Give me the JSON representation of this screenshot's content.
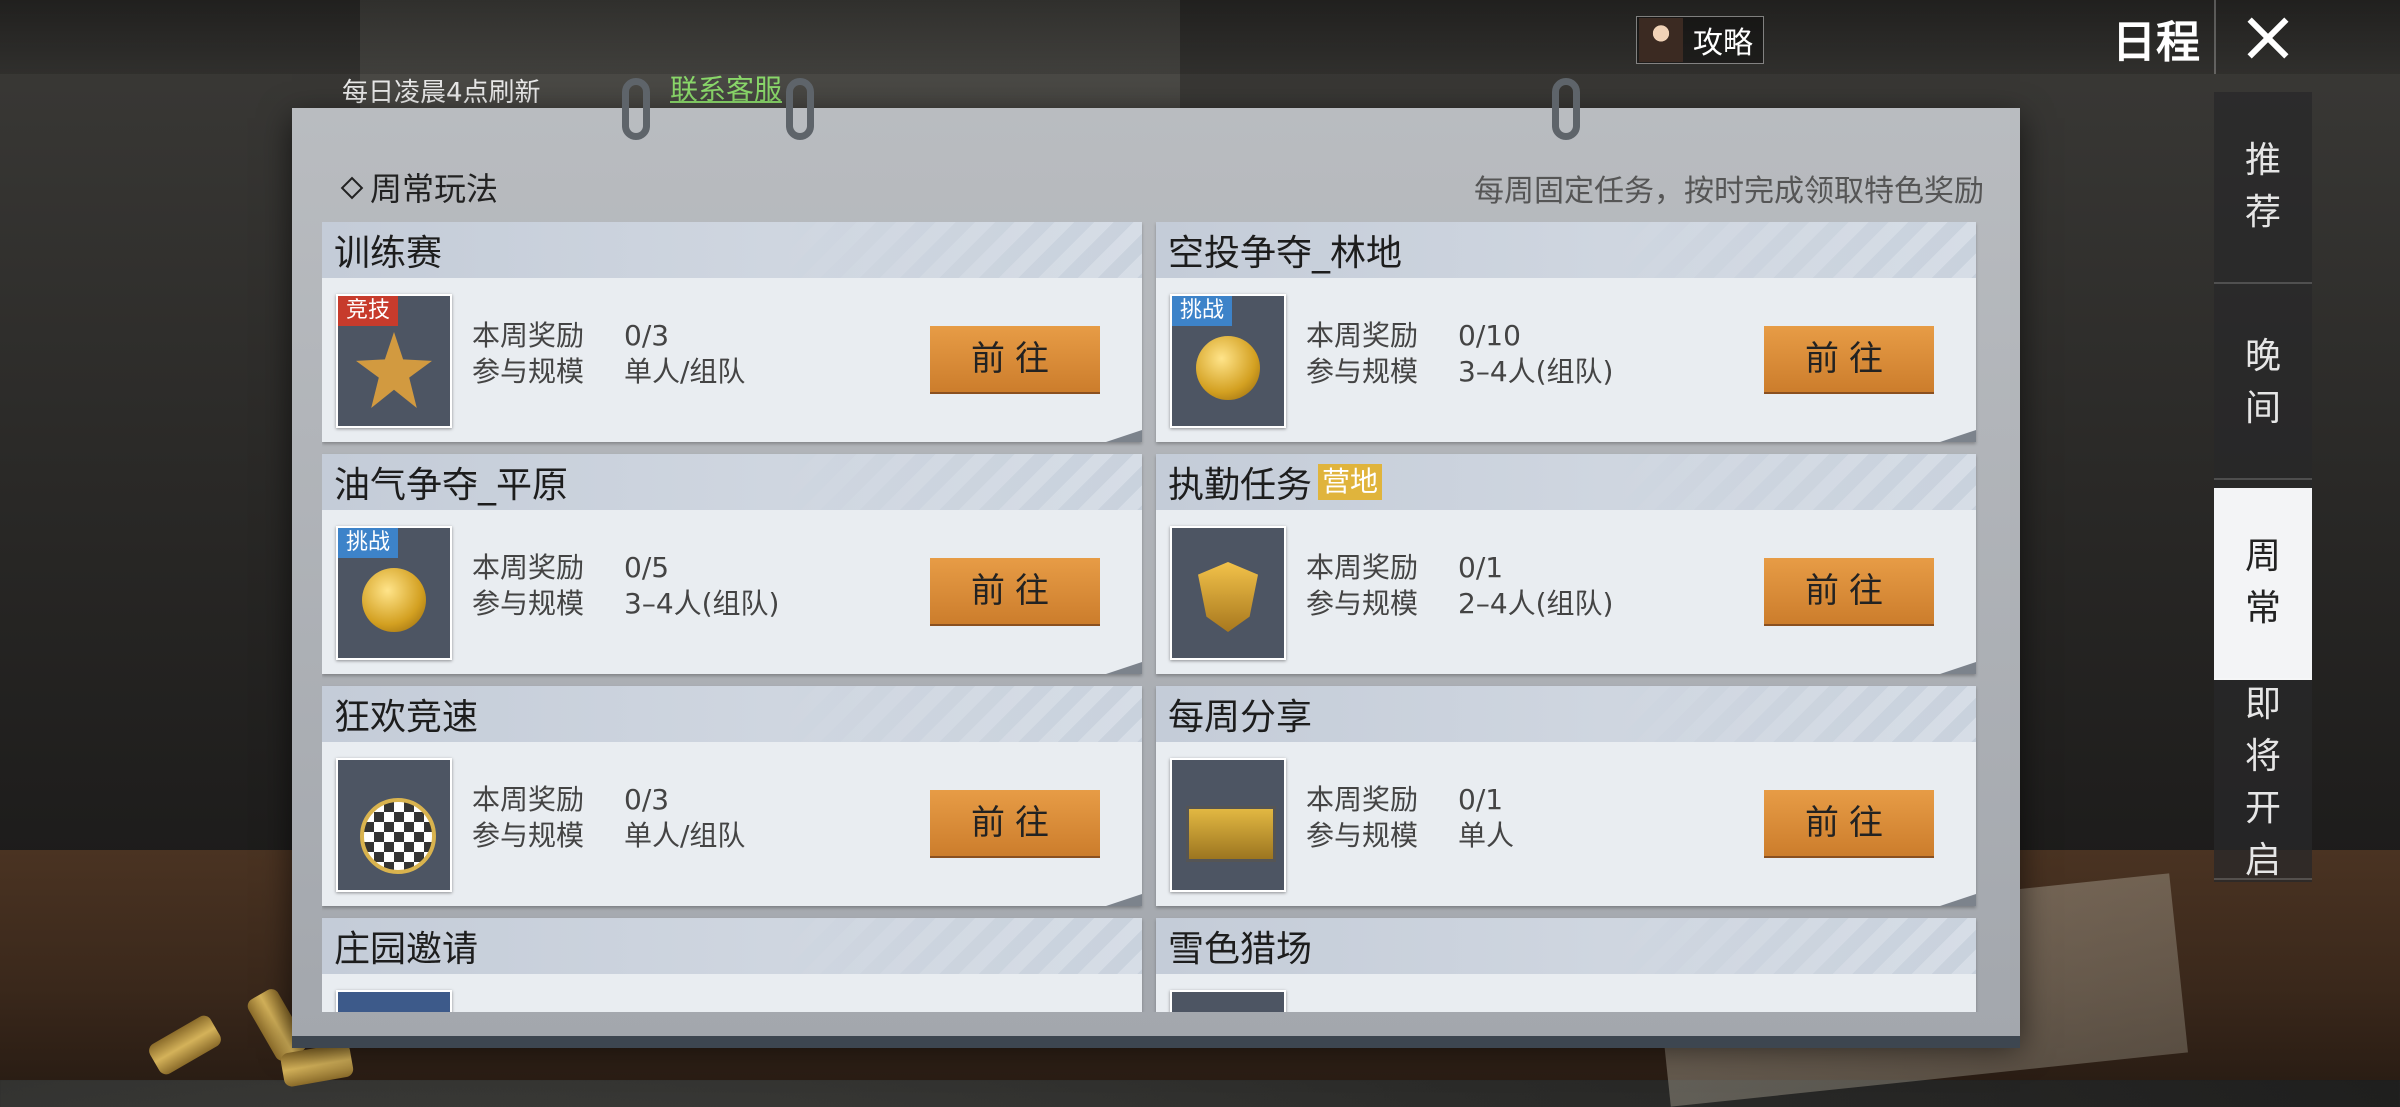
{
  "top": {
    "guide_label": "攻略",
    "title": "日程",
    "refresh_note": "每日凌晨4点刷新",
    "support_link": "联系客服"
  },
  "section": {
    "title": "周常玩法",
    "note": "每周固定任务，按时完成领取特色奖励"
  },
  "labels": {
    "reward": "本周奖励",
    "scale": "参与规模",
    "go": "前往"
  },
  "cards": [
    {
      "title": "训练赛",
      "badge": "竞技",
      "badge_color": "#c73b2c",
      "icon": "star-medal-icon",
      "reward": "0/3",
      "scale": "单人/组队"
    },
    {
      "title": "空投争夺_林地",
      "badge": "挑战",
      "badge_color": "#3d83c9",
      "icon": "gold-coin-icon",
      "reward": "0/10",
      "scale": "3–4人(组队)"
    },
    {
      "title": "油气争夺_平原",
      "badge": "挑战",
      "badge_color": "#3d83c9",
      "icon": "gold-coin-icon",
      "reward": "0/5",
      "scale": "3–4人(组队)"
    },
    {
      "title": "执勤任务",
      "tag": "营地",
      "icon": "shield-emblem-icon",
      "reward": "0/1",
      "scale": "2–4人(组队)"
    },
    {
      "title": "狂欢竞速",
      "icon": "race-flag-coin-icon",
      "reward": "0/3",
      "scale": "单人/组队"
    },
    {
      "title": "每周分享",
      "icon": "supply-crate-icon",
      "reward": "0/1",
      "scale": "单人"
    },
    {
      "title": "庄园邀请"
    },
    {
      "title": "雪色猎场"
    }
  ],
  "side_nav": [
    {
      "label": "推荐",
      "active": false
    },
    {
      "label": "晚间",
      "active": false
    },
    {
      "label": "周常",
      "active": true
    },
    {
      "label": "即将开启",
      "active": false
    }
  ]
}
